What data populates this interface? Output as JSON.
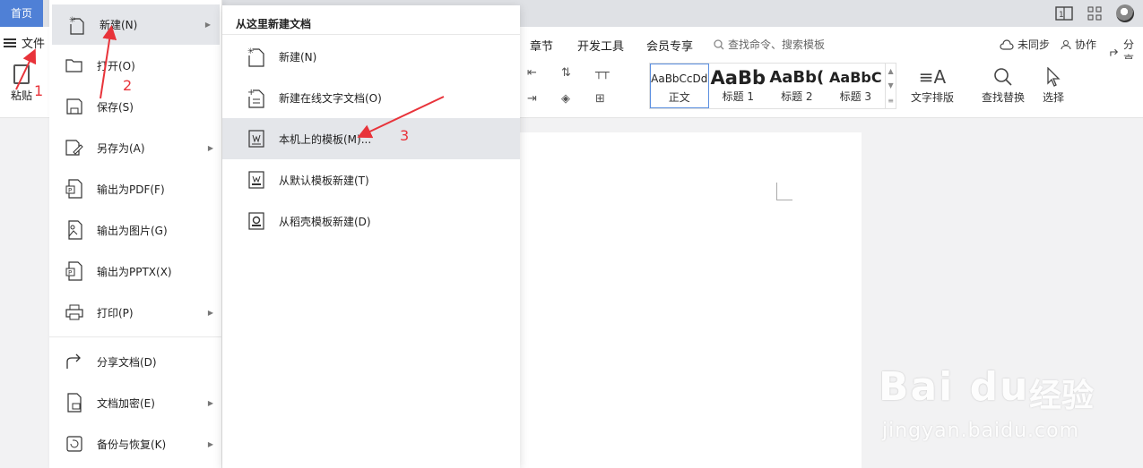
{
  "titlebar": {
    "home_tab": "首页",
    "icons": [
      "reading-mode-icon",
      "apps-grid-icon",
      "user-avatar-icon"
    ]
  },
  "ribbon_tabs": {
    "file_label": "文件",
    "tabs": [
      "章节",
      "开发工具",
      "会员专享"
    ],
    "search_placeholder": "查找命令、搜索模板",
    "sync_label": "未同步",
    "collab_label": "协作",
    "share_label": "分享"
  },
  "ribbon": {
    "paste_label": "粘贴",
    "styles": [
      {
        "sample": "AaBbCcDd",
        "name": "正文"
      },
      {
        "sample": "AaBb",
        "name": "标题 1"
      },
      {
        "sample": "AaBb(",
        "name": "标题 2"
      },
      {
        "sample": "AaBbC",
        "name": "标题 3"
      }
    ],
    "text_layout_label": "文字排版",
    "find_replace_label": "查找替换",
    "select_label": "选择"
  },
  "file_menu": {
    "items": [
      {
        "label": "新建(N)",
        "icon": "new-doc-icon",
        "has_submenu": true,
        "active": true
      },
      {
        "label": "打开(O)",
        "icon": "open-folder-icon",
        "has_submenu": false
      },
      {
        "label": "保存(S)",
        "icon": "save-icon",
        "has_submenu": false
      },
      {
        "label": "另存为(A)",
        "icon": "save-as-icon",
        "has_submenu": true
      },
      {
        "label": "输出为PDF(F)",
        "icon": "export-pdf-icon",
        "has_submenu": false
      },
      {
        "label": "输出为图片(G)",
        "icon": "export-image-icon",
        "has_submenu": false
      },
      {
        "label": "输出为PPTX(X)",
        "icon": "export-pptx-icon",
        "has_submenu": false
      },
      {
        "label": "打印(P)",
        "icon": "print-icon",
        "has_submenu": true
      },
      {
        "label": "分享文档(D)",
        "icon": "share-doc-icon",
        "has_submenu": false
      },
      {
        "label": "文档加密(E)",
        "icon": "encrypt-doc-icon",
        "has_submenu": true
      },
      {
        "label": "备份与恢复(K)",
        "icon": "backup-restore-icon",
        "has_submenu": true
      }
    ]
  },
  "submenu": {
    "title": "从这里新建文档",
    "items": [
      {
        "label": "新建(N)",
        "icon": "new-blank-doc-icon"
      },
      {
        "label": "新建在线文字文档(O)",
        "icon": "new-online-doc-icon"
      },
      {
        "label": "本机上的模板(M)...",
        "icon": "local-template-icon",
        "highlighted": true
      },
      {
        "label": "从默认模板新建(T)",
        "icon": "default-template-icon"
      },
      {
        "label": "从稻壳模板新建(D)",
        "icon": "docer-template-icon"
      }
    ]
  },
  "annotations": [
    "1",
    "2",
    "3"
  ],
  "colors": {
    "home_tab_bg": "#4f80d6",
    "annotation": "#e8333a",
    "highlight": "#e4e6ea"
  },
  "watermark": {
    "brand": "Bai du",
    "brand_cn": "经验",
    "url": "jingyan.baidu.com"
  }
}
